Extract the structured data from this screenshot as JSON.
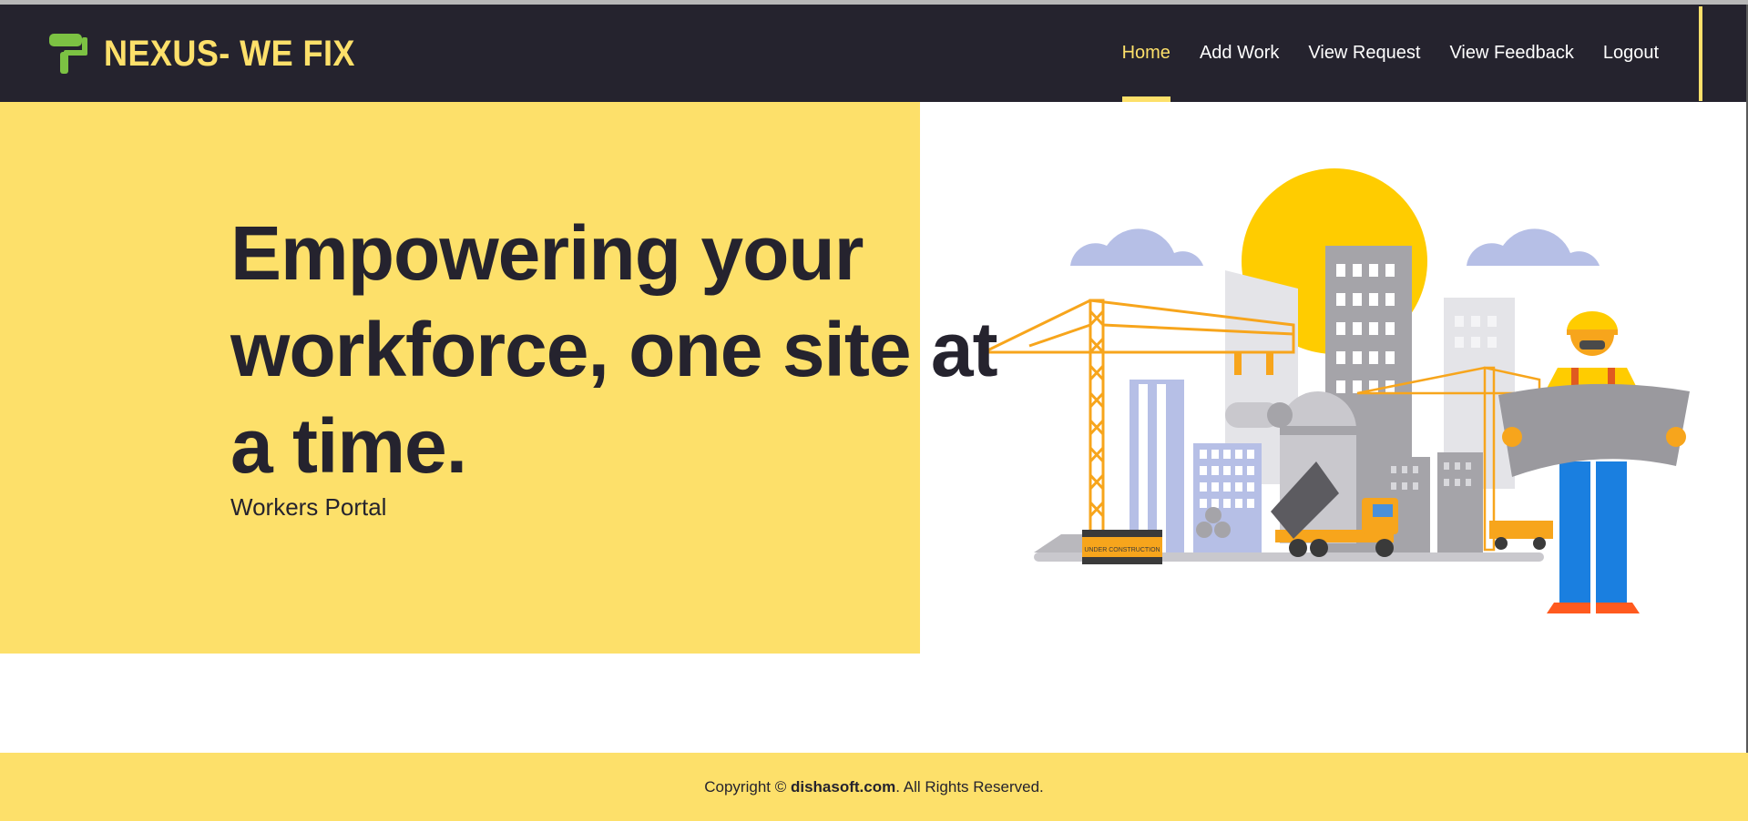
{
  "brand": {
    "name": "NEXUS- WE FIX",
    "icon": "paint-roller-icon",
    "icon_color": "#7cc243"
  },
  "nav": {
    "items": [
      {
        "label": "Home",
        "active": true
      },
      {
        "label": "Add Work",
        "active": false
      },
      {
        "label": "View Request",
        "active": false
      },
      {
        "label": "View Feedback",
        "active": false
      },
      {
        "label": "Logout",
        "active": false
      }
    ]
  },
  "hero": {
    "title": "Empowering your workforce, one site at a time.",
    "subtitle": "Workers Portal",
    "illustration": "construction-site-illustration",
    "sign_text": "UNDER CONSTRUCTION"
  },
  "footer": {
    "prefix": "Copyright ©",
    "site": "dishasoft.com",
    "suffix": ". All Rights Reserved."
  },
  "colors": {
    "accent": "#fde06a",
    "dark": "#25232e",
    "sun": "#ffcc00",
    "crane": "#f7a51c"
  }
}
